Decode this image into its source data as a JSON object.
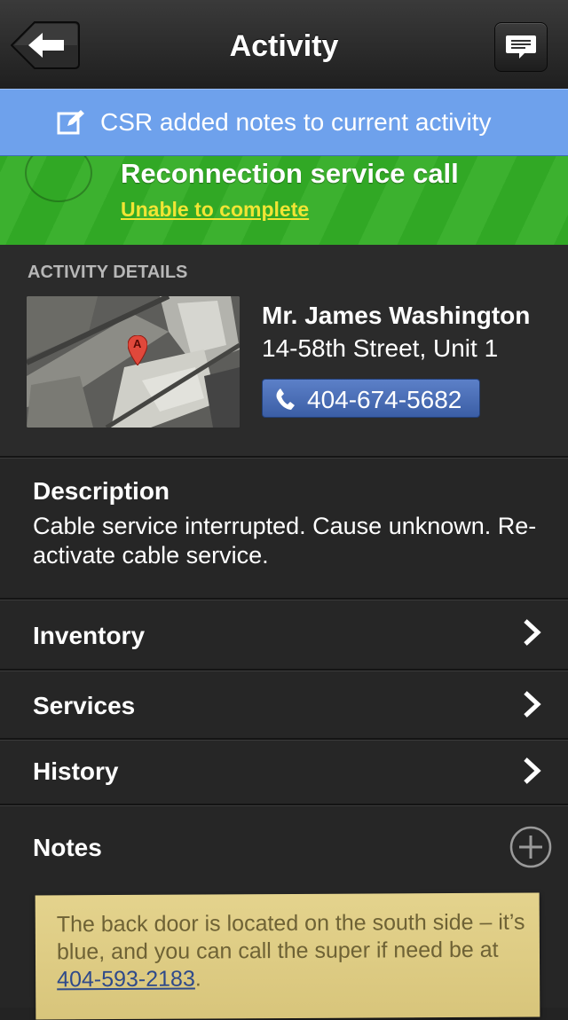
{
  "header": {
    "title": "Activity"
  },
  "notification": {
    "text": "CSR added notes to current activity"
  },
  "status": {
    "title": "Reconnection service call",
    "link": "Unable to complete",
    "color": "#3cb12f"
  },
  "details": {
    "section_label": "ACTIVITY DETAILS",
    "map_pin_label": "A",
    "customer_name": "Mr. James Washington",
    "address": "14-58th Street, Unit 1",
    "phone": "404-674-5682"
  },
  "description": {
    "label": "Description",
    "text": "Cable service interrupted. Cause unknown. Re-activate cable service."
  },
  "rows": [
    {
      "label": "Inventory"
    },
    {
      "label": "Services"
    },
    {
      "label": "History"
    }
  ],
  "notes": {
    "label": "Notes",
    "text_before": "The back door is located on the south side – it’s blue, and you can call the super if need be at ",
    "phone": "404-593-2183",
    "text_after": "."
  },
  "icons": {
    "back": "back-arrow-icon",
    "chat": "chat-bubble-icon",
    "edit": "edit-note-icon",
    "phone": "phone-icon",
    "chevron": "chevron-right-icon",
    "add": "plus-circle-icon",
    "map_pin": "map-pin-icon"
  }
}
